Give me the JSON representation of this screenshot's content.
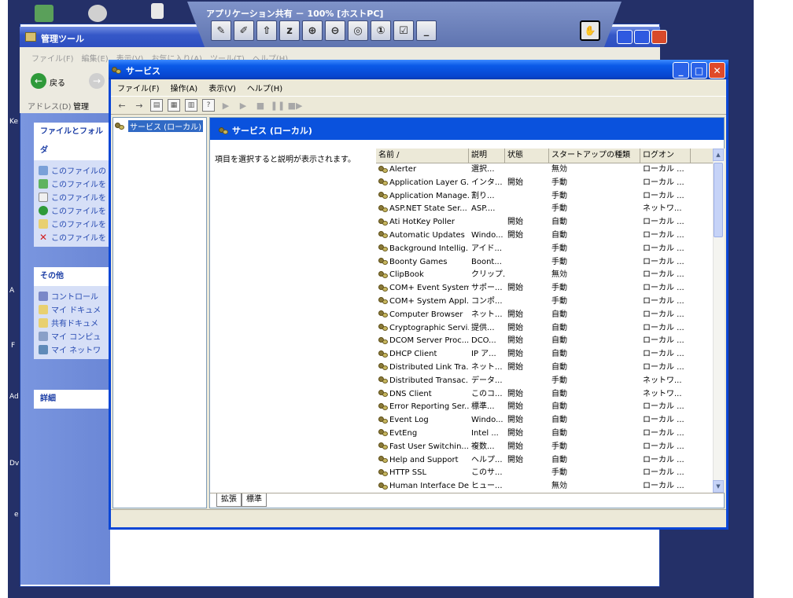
{
  "share_bar": {
    "title": "アプリケーション共有 － 100% [ホストPC]",
    "tools": [
      "pen-icon",
      "edit-icon",
      "upload-icon",
      "z-icon",
      "zoom-in-icon",
      "zoom-out-icon",
      "zoom-fit-icon",
      "zoom-actual-icon",
      "check-icon",
      "minimize-icon"
    ]
  },
  "back_window": {
    "title": "管理ツール",
    "menubar": "ファイル(F)　編集(E)　表示(V)　お気に入り(A)　ツール(T)　ヘルプ(H)",
    "back_label": "戻る",
    "address_label": "アドレス(D)",
    "address_value": "管理",
    "file_tasks": {
      "title": "ファイルとフォルダ",
      "items": [
        "このファイルの",
        "このファイルを",
        "このファイルを",
        "このファイルを",
        "このファイルを 　する",
        "このファイルを"
      ]
    },
    "other": {
      "title": "その他",
      "items": [
        "コントロール",
        "マイ ドキュメ",
        "共有ドキュメ",
        "マイ コンピュ",
        "マイ ネットワ"
      ]
    },
    "details": {
      "title": "詳細"
    }
  },
  "desktop_labels": [
    "Ke",
    "A",
    "F",
    "Ad",
    "Dv",
    "e"
  ],
  "services_window": {
    "title": "サービス",
    "menu": [
      "ファイル(F)",
      "操作(A)",
      "表示(V)",
      "ヘルプ(H)"
    ],
    "tree_item": "サービス (ローカル)",
    "header": "サービス (ローカル)",
    "description": "項目を選択すると説明が表示されます。",
    "columns": [
      "名前 /",
      "説明",
      "状態",
      "スタートアップの種類",
      "ログオン"
    ],
    "rows": [
      [
        "Alerter",
        "選択...",
        "",
        "無効",
        "ローカル ..."
      ],
      [
        "Application Layer G...",
        "インタ...",
        "開始",
        "手動",
        "ローカル ..."
      ],
      [
        "Application Manage...",
        "割り...",
        "",
        "手動",
        "ローカル ..."
      ],
      [
        "ASP.NET State Ser...",
        "ASP....",
        "",
        "手動",
        "ネットワ..."
      ],
      [
        "Ati HotKey Poller",
        "",
        "開始",
        "自動",
        "ローカル ..."
      ],
      [
        "Automatic Updates",
        "Windo...",
        "開始",
        "自動",
        "ローカル ..."
      ],
      [
        "Background Intellig...",
        "アイド...",
        "",
        "手動",
        "ローカル ..."
      ],
      [
        "Boonty Games",
        "Boont...",
        "",
        "手動",
        "ローカル ..."
      ],
      [
        "ClipBook",
        "クリップ...",
        "",
        "無効",
        "ローカル ..."
      ],
      [
        "COM+ Event System",
        "サポー...",
        "開始",
        "手動",
        "ローカル ..."
      ],
      [
        "COM+ System Appl...",
        "コンポ...",
        "",
        "手動",
        "ローカル ..."
      ],
      [
        "Computer Browser",
        "ネット...",
        "開始",
        "自動",
        "ローカル ..."
      ],
      [
        "Cryptographic Servi...",
        "提供...",
        "開始",
        "自動",
        "ローカル ..."
      ],
      [
        "DCOM Server Proc...",
        "DCO...",
        "開始",
        "自動",
        "ローカル ..."
      ],
      [
        "DHCP Client",
        "IP ア...",
        "開始",
        "自動",
        "ローカル ..."
      ],
      [
        "Distributed Link Tra...",
        "ネット...",
        "開始",
        "自動",
        "ローカル ..."
      ],
      [
        "Distributed Transac...",
        "データ...",
        "",
        "手動",
        "ネットワ..."
      ],
      [
        "DNS Client",
        "このコ...",
        "開始",
        "自動",
        "ネットワ..."
      ],
      [
        "Error Reporting Ser...",
        "標準...",
        "開始",
        "自動",
        "ローカル ..."
      ],
      [
        "Event Log",
        "Windo...",
        "開始",
        "自動",
        "ローカル ..."
      ],
      [
        "EvtEng",
        "Intel ...",
        "開始",
        "自動",
        "ローカル ..."
      ],
      [
        "Fast User Switchin...",
        "複数...",
        "開始",
        "手動",
        "ローカル ..."
      ],
      [
        "Help and Support",
        "ヘルプ...",
        "開始",
        "自動",
        "ローカル ..."
      ],
      [
        "HTTP SSL",
        "このサ...",
        "",
        "手動",
        "ローカル ..."
      ],
      [
        "Human Interface De...",
        "ヒュー...",
        "",
        "無効",
        "ローカル ..."
      ]
    ],
    "tabs": [
      "拡張",
      "標準"
    ]
  }
}
